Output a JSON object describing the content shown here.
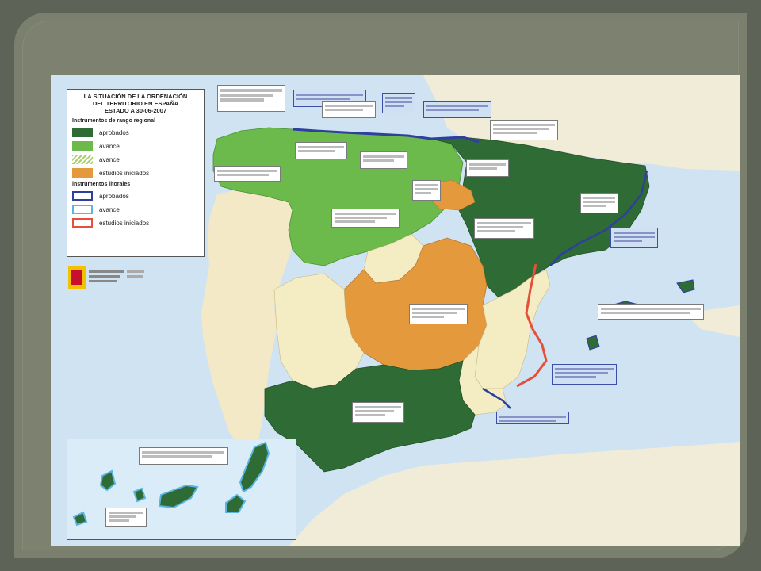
{
  "legend": {
    "title_lines": [
      "LA SITUACIÓN DE LA ORDENACIÓN",
      "DEL TERRITORIO EN ESPAÑA",
      "ESTADO A 30-06-2007"
    ],
    "regional_heading": "Instrumentos de rango regional",
    "regional_items": [
      {
        "label": "aprobados",
        "color": "#2f6b34"
      },
      {
        "label": "avance",
        "color": "#6cb94c"
      },
      {
        "label": "avance",
        "color": "#a8cf6a",
        "pattern": "hatched"
      },
      {
        "label": "estudios iniciados",
        "color": "#e49a3c"
      }
    ],
    "coastal_heading": "instrumentos litorales",
    "coastal_items": [
      {
        "label": "aprobados",
        "color": "#2f3f9e"
      },
      {
        "label": "avance",
        "color": "#5ab5e0"
      },
      {
        "label": "estudios iniciados",
        "color": "#e6503a"
      }
    ]
  },
  "colors": {
    "sea": "#cfe3f3",
    "neighbor_land": "#f1ecd7",
    "unmapped_region": "#f4ecc3",
    "approved": "#2f6b34",
    "draft": "#6cb94c",
    "studies": "#e49a3c",
    "coast_approved": "#2f3f9e",
    "coast_studies": "#e6503a"
  },
  "icons": {
    "emblem": "spain-government-emblem-icon"
  }
}
